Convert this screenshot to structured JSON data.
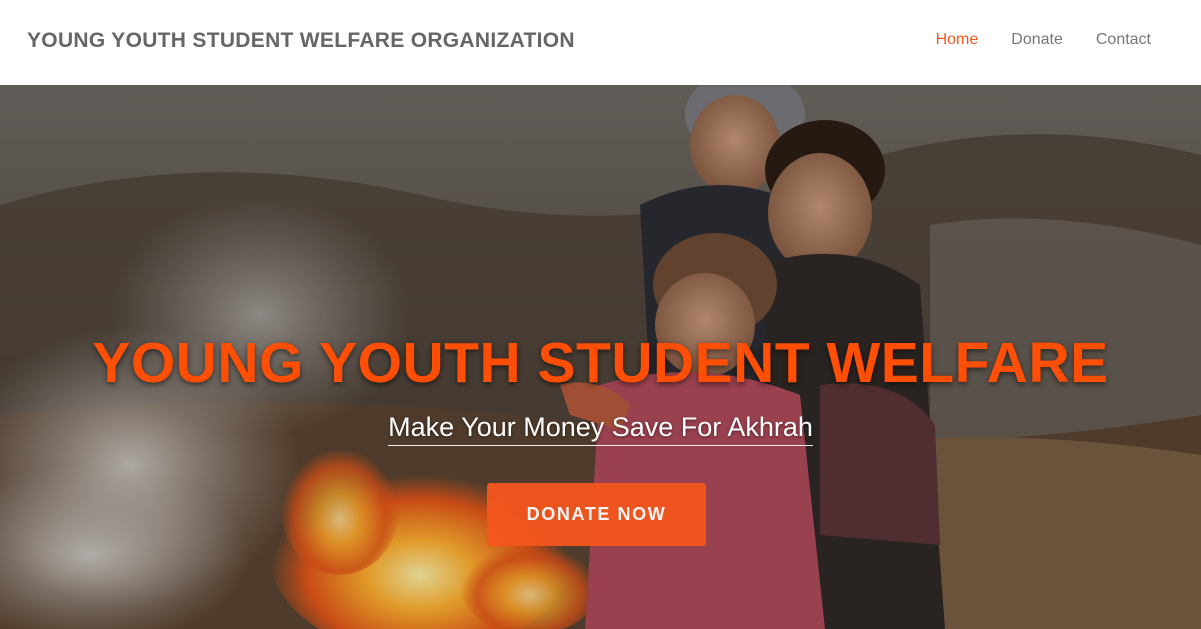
{
  "brand": {
    "name": "YOUNG YOUTH STUDENT WELFARE ORGANIZATION"
  },
  "nav": {
    "items": [
      {
        "label": "Home",
        "active": true
      },
      {
        "label": "Donate",
        "active": false
      },
      {
        "label": "Contact",
        "active": false
      }
    ]
  },
  "hero": {
    "title": "YOUNG YOUTH STUDENT WELFARE",
    "subtitle": "Make Your Money Save For Akhrah",
    "cta_label": "DONATE NOW",
    "image": "photo of three children warming hands by a fire on a hillside"
  },
  "colors": {
    "accent": "#f05a1f",
    "title": "#ff4e05",
    "button": "#f4561d",
    "nav_text": "#777777",
    "brand_text": "#666666"
  }
}
